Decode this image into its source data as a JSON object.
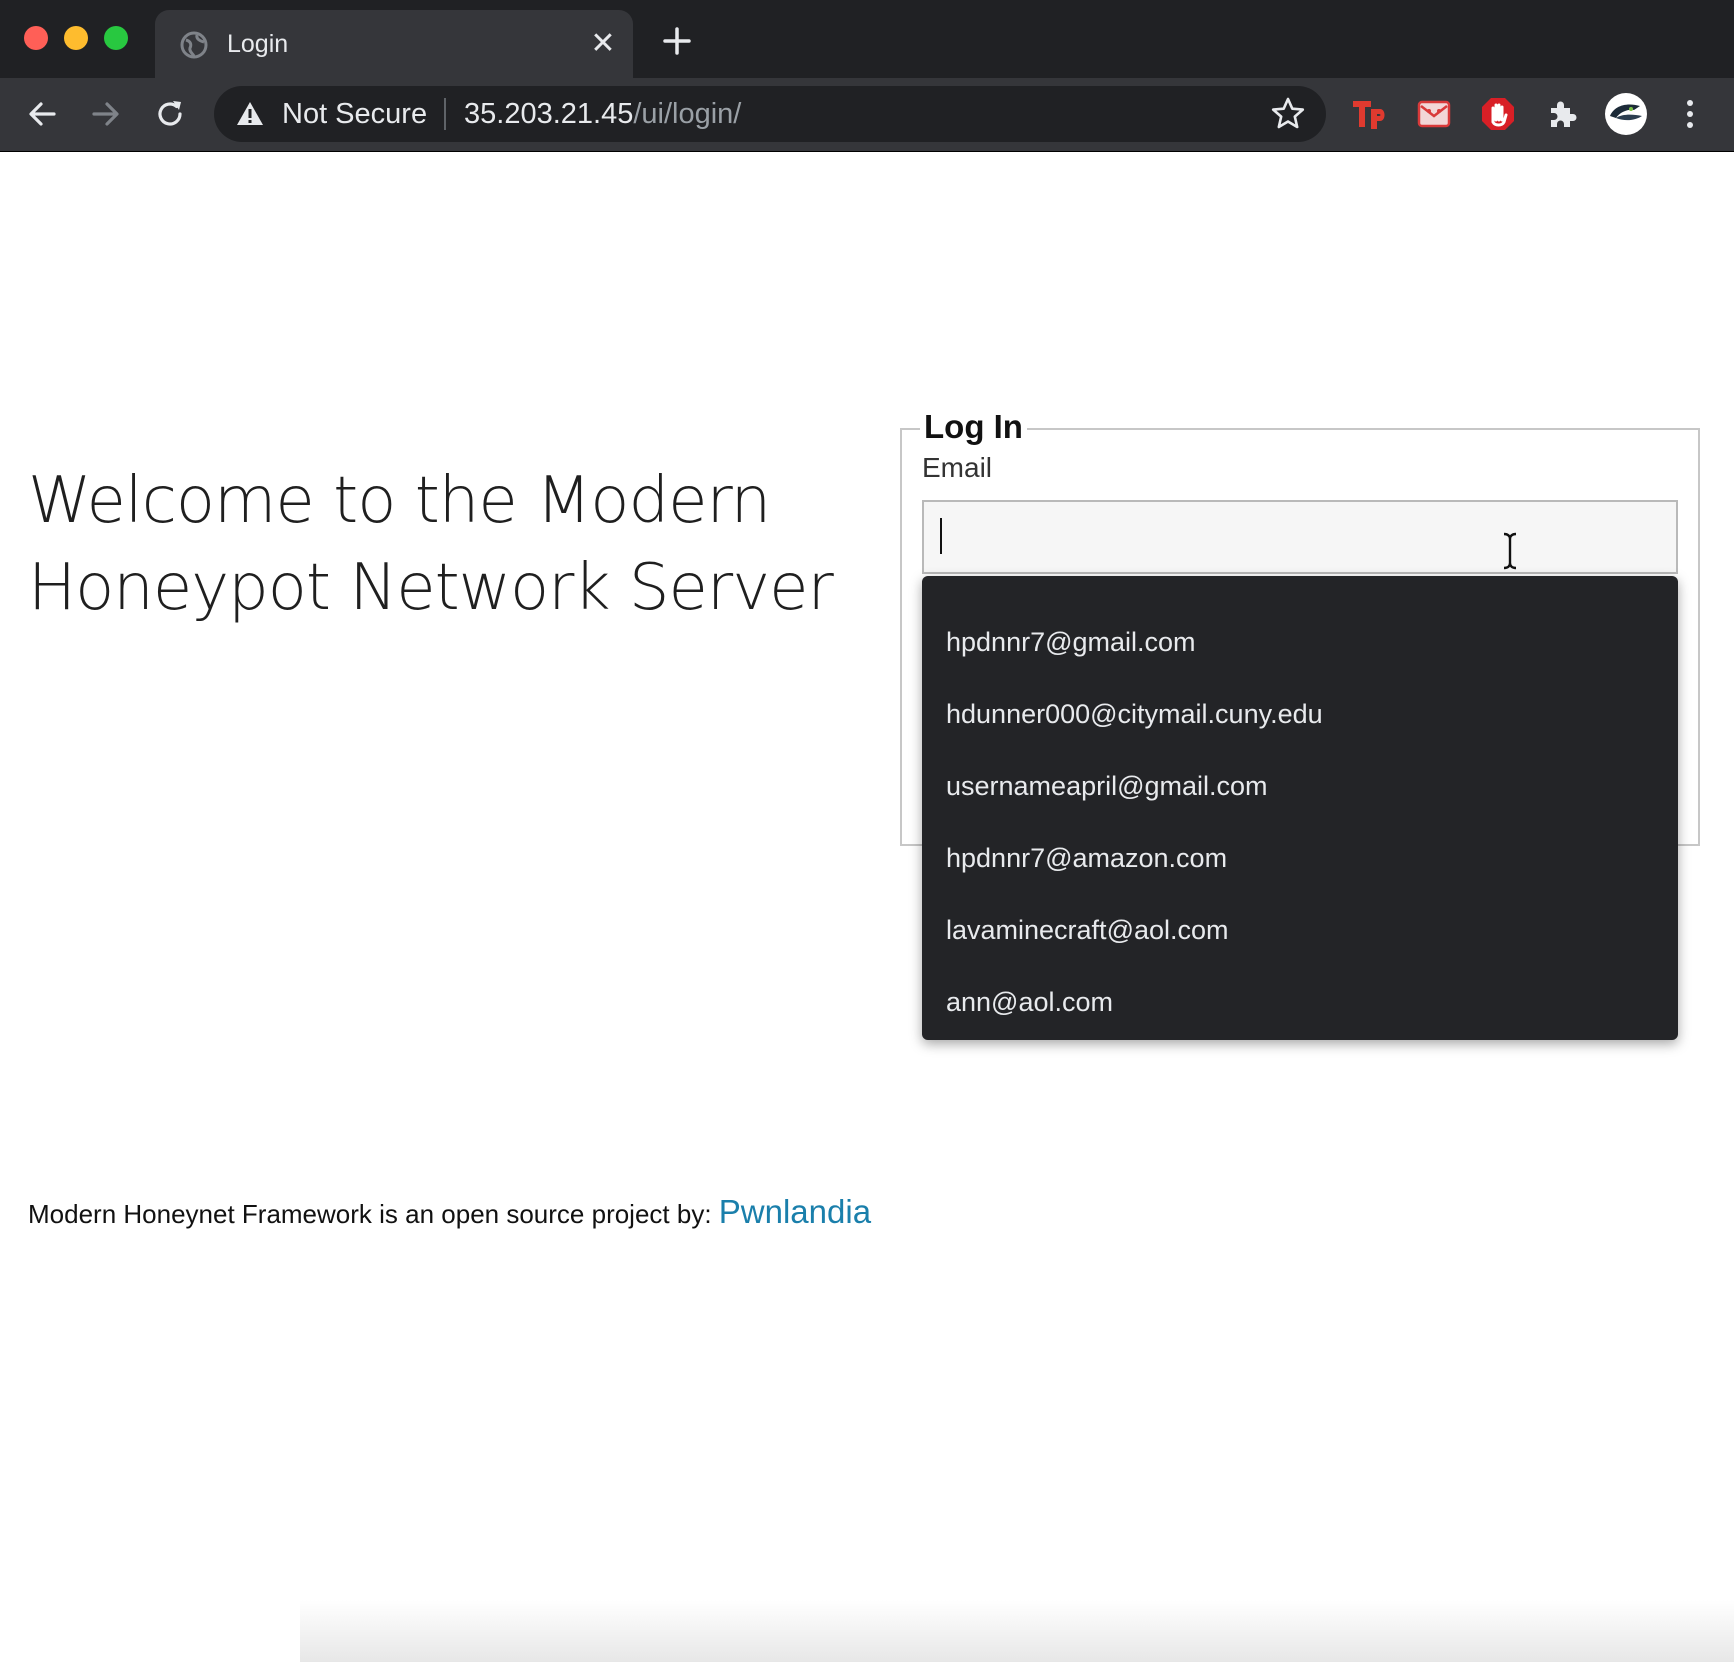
{
  "browser": {
    "tab_title": "Login",
    "tab_close_glyph": "✕",
    "security_label": "Not Secure",
    "url_host": "35.203.21.45",
    "url_path": "/ui/login/",
    "icons": [
      "back-icon",
      "forward-icon",
      "reload-icon",
      "warning-icon",
      "star-icon",
      "tp-extension-icon",
      "mail-extension-icon",
      "stop-hand-extension-icon",
      "puzzle-extension-icon",
      "profile-avatar-icon",
      "kebab-menu-icon"
    ]
  },
  "page": {
    "welcome_line1": "Welcome to the Modern",
    "welcome_line2": "Honeypot Network Server",
    "login": {
      "legend": "Log In",
      "email_label": "Email",
      "email_value": ""
    },
    "autocomplete": [
      "hpdnnr7@gmail.com",
      "hdunner000@citymail.cuny.edu",
      "usernameapril@gmail.com",
      "hpdnnr7@amazon.com",
      "lavaminecraft@aol.com",
      "ann@aol.com"
    ],
    "footer": {
      "text": "Modern Honeynet Framework is an open source project by: ",
      "link_text": "Pwnlandia"
    }
  },
  "colors": {
    "chrome_dark": "#202124",
    "toolbar": "#35363a",
    "link": "#1a7fab",
    "autocomplete_bg": "#232427"
  }
}
